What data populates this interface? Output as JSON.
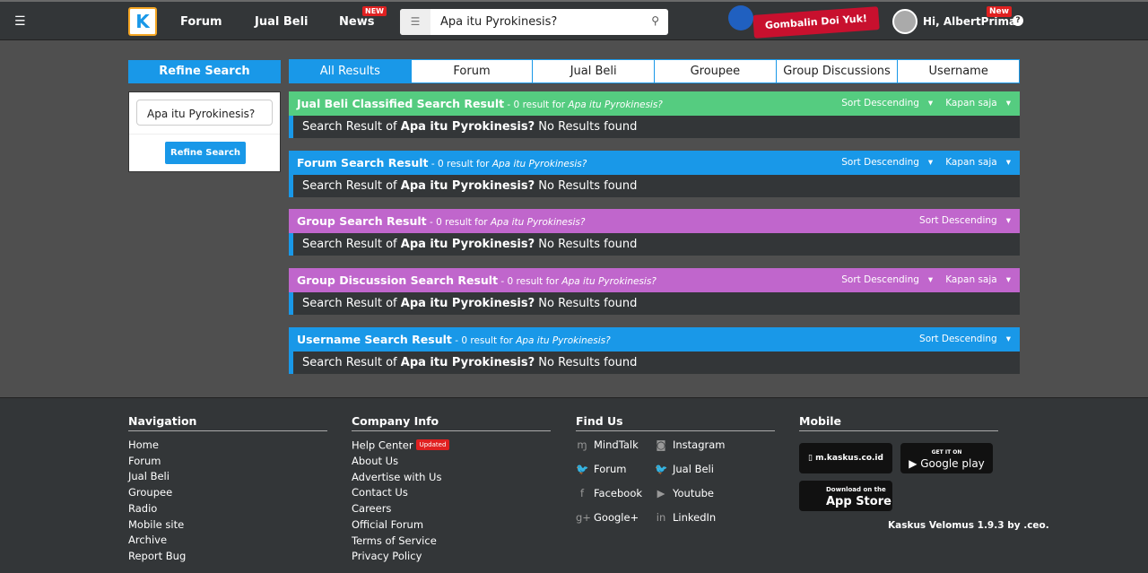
{
  "header": {
    "menu_icon": "hamburger-icon",
    "logo": "K",
    "nav": [
      {
        "label": "Forum"
      },
      {
        "label": "Jual Beli"
      },
      {
        "label": "News",
        "badge": "NEW"
      }
    ],
    "search_value": "Apa itu Pyrokinesis?",
    "banner": "Gombalin Doi Yuk!",
    "user": "Hi, AlbertPrima",
    "user_badge": "New"
  },
  "refine": {
    "title": "Refine Search",
    "input_value": "Apa itu Pyrokinesis?",
    "button": "Refine Search"
  },
  "tabs": [
    "All Results",
    "Forum",
    "Jual Beli",
    "Groupee",
    "Group Discussions",
    "Username"
  ],
  "sections": [
    {
      "title": "Jual Beli Classified Search Result",
      "sub": " - 0 result for ",
      "query": "Apa itu Pyrokinesis?",
      "color": "#55cc80",
      "sort": "Sort Descending",
      "time": "Kapan saja",
      "result_pre": "Search Result of ",
      "result_q": "Apa itu Pyrokinesis?",
      "result_post": " No Results found"
    },
    {
      "title": "Forum Search Result",
      "sub": " - 0 result for ",
      "query": "Apa itu Pyrokinesis?",
      "color": "#1998e8",
      "sort": "Sort Descending",
      "time": "Kapan saja",
      "result_pre": "Search Result of ",
      "result_q": "Apa itu Pyrokinesis?",
      "result_post": " No Results found"
    },
    {
      "title": "Group Search Result",
      "sub": " - 0 result for ",
      "query": "Apa itu Pyrokinesis?",
      "color": "#c066cc",
      "sort": "Sort Descending",
      "result_pre": "Search Result of ",
      "result_q": "Apa itu Pyrokinesis?",
      "result_post": " No Results found"
    },
    {
      "title": "Group Discussion Search Result",
      "sub": " - 0 result for ",
      "query": "Apa itu Pyrokinesis?",
      "color": "#c066cc",
      "sort": "Sort Descending",
      "time": "Kapan saja",
      "result_pre": "Search Result of ",
      "result_q": "Apa itu Pyrokinesis?",
      "result_post": " No Results found"
    },
    {
      "title": "Username Search Result",
      "sub": " - 0 result for ",
      "query": "Apa itu Pyrokinesis?",
      "color": "#1998e8",
      "sort": "Sort Descending",
      "result_pre": "Search Result of ",
      "result_q": "Apa itu Pyrokinesis?",
      "result_post": " No Results found"
    }
  ],
  "footer": {
    "navigation": {
      "title": "Navigation",
      "links": [
        "Home",
        "Forum",
        "Jual Beli",
        "Groupee",
        "Radio",
        "Mobile site",
        "Archive",
        "Report Bug"
      ]
    },
    "company": {
      "title": "Company Info",
      "links": [
        "Help Center",
        "About Us",
        "Advertise with Us",
        "Contact Us",
        "Careers",
        "Official Forum",
        "Terms of Service",
        "Privacy Policy"
      ],
      "badge": "Updated"
    },
    "findus": {
      "title": "Find Us",
      "links": [
        {
          "label": "MindTalk",
          "icon": "mindtalk-icon",
          "g": "ɱ"
        },
        {
          "label": "Instagram",
          "icon": "instagram-icon",
          "g": "◙"
        },
        {
          "label": "Forum",
          "icon": "twitter-icon",
          "g": "🐦"
        },
        {
          "label": "Jual Beli",
          "icon": "twitter-icon",
          "g": "🐦"
        },
        {
          "label": "Facebook",
          "icon": "facebook-icon",
          "g": "f"
        },
        {
          "label": "Youtube",
          "icon": "youtube-icon",
          "g": "▶"
        },
        {
          "label": "Google+",
          "icon": "googleplus-icon",
          "g": "g+"
        },
        {
          "label": "LinkedIn",
          "icon": "linkedin-icon",
          "g": "in"
        }
      ]
    },
    "mobile": {
      "title": "Mobile",
      "site": "m.kaskus.co.id",
      "gplay_small": "GET IT ON",
      "gplay": "Google play",
      "appstore_small": "Download on the",
      "appstore": "App Store"
    },
    "version": "Kaskus Velomus 1.9.3 by .ceo."
  }
}
